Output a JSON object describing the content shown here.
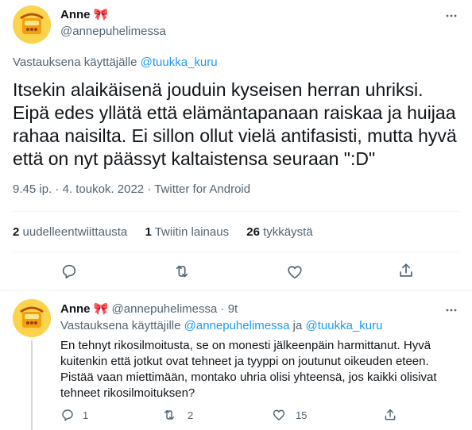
{
  "main": {
    "author_name": "Anne",
    "author_emoji": "🎀",
    "author_handle": "@annepuhelimessa",
    "reply_prefix": "Vastauksena käyttäjälle",
    "reply_to": "@tuukka_kuru",
    "text_lines": [
      "Itsekin alaikäisenä jouduin kyseisen herran uhriksi.",
      "Eipä edes yllätä että elämäntapanaan raiskaa ja huijaa",
      "rahaa naisilta. Ei sillon ollut vielä antifasisti, mutta hyvä",
      "että on nyt päässyt kaltaistensa seuraan \":D\""
    ],
    "time": "9.45 ip.",
    "sep1": "·",
    "date": "4. toukok. 2022",
    "sep2": "·",
    "source": "Twitter for Android",
    "stats": {
      "retweets_num": "2",
      "retweets_label": "uudelleentwiittausta",
      "quotes_num": "1",
      "quotes_label": "Twiitin lainaus",
      "likes_num": "26",
      "likes_label": "tykkäystä"
    }
  },
  "reply": {
    "author_name": "Anne",
    "author_emoji": "🎀",
    "author_handle": "@annepuhelimessa",
    "sep": "·",
    "age": "9t",
    "reply_prefix": "Vastauksena käyttäjille",
    "reply_to_1": "@annepuhelimessa",
    "reply_and": "ja",
    "reply_to_2": "@tuukka_kuru",
    "text_lines": [
      "En tehnyt rikosilmoitusta, se on monesti jälkeenpäin harmittanut. Hyvä",
      "kuitenkin että jotkut ovat tehneet ja tyyppi on joutunut oikeuden eteen.",
      "Pistää vaan miettimään, montako uhria olisi yhteensä, jos kaikki olisivat",
      "tehneet rikosilmoituksen?"
    ],
    "counts": {
      "replies": "1",
      "retweets": "2",
      "likes": "15"
    }
  },
  "icons": {
    "more": "more-icon",
    "reply": "reply-icon",
    "retweet": "retweet-icon",
    "like": "like-icon",
    "share": "share-icon"
  },
  "colors": {
    "link": "#1d9bf0",
    "secondary_text": "#536471",
    "divider": "#eff3f4",
    "avatar_bg": "#fcd34d"
  }
}
